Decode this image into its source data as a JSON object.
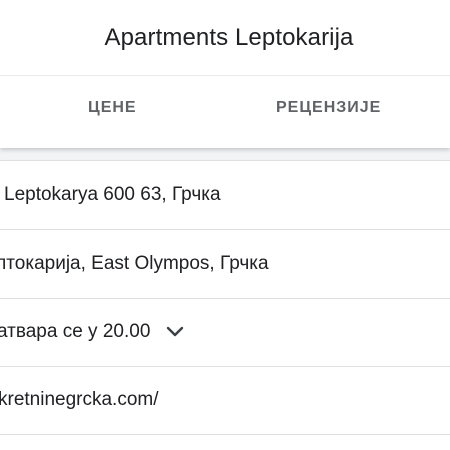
{
  "header": {
    "title": "Apartments Leptokarija",
    "tabs": [
      {
        "label": "ЦЕНЕ"
      },
      {
        "label": "РЕЦЕНЗИЈЕ"
      }
    ]
  },
  "details": {
    "address": "Leptokarya 600 63, Грчка",
    "locality": "птокарија, East Olympos, Грчка",
    "hours": "атвара се у 20.00",
    "website": "kretninegrcka.com/"
  },
  "icons": {
    "hours_expand": "chevron-down-icon"
  },
  "colors": {
    "text": "#202124",
    "tab_text": "#5f6368",
    "divider": "#e0e0e0",
    "gap_background": "#f1f3f4"
  }
}
